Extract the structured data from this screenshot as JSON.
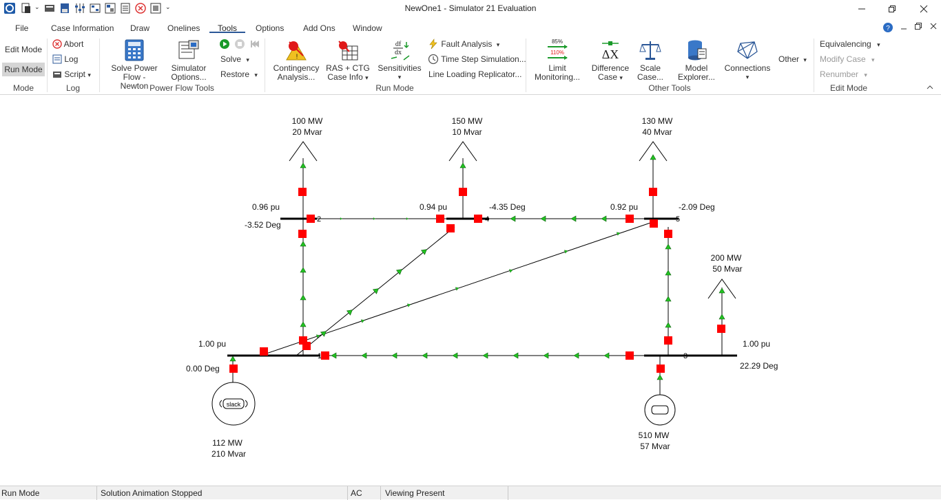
{
  "window": {
    "title": "NewOne1 - Simulator 21 Evaluation"
  },
  "menu": {
    "tabs": [
      "File",
      "Case Information",
      "Draw",
      "Onelines",
      "Tools",
      "Options",
      "Add Ons",
      "Window"
    ],
    "active_tab": "Tools"
  },
  "ribbon": {
    "mode": {
      "edit_mode": "Edit Mode",
      "run_mode": "Run Mode",
      "group": "Mode"
    },
    "log": {
      "abort": "Abort",
      "log": "Log",
      "script": "Script",
      "group": "Log"
    },
    "power_flow_tools": {
      "solve_line1": "Solve Power",
      "solve_line2": "Flow - Newton",
      "options_line1": "Simulator",
      "options_line2": "Options...",
      "solve": "Solve",
      "restore": "Restore",
      "group": "Power Flow Tools"
    },
    "run_mode": {
      "contingency_line1": "Contingency",
      "contingency_line2": "Analysis...",
      "ras_line1": "RAS + CTG",
      "ras_line2": "Case Info",
      "sensitivities": "Sensitivities",
      "fault_analysis": "Fault Analysis",
      "time_step": "Time Step Simulation...",
      "line_loading": "Line Loading Replicator...",
      "group": "Run Mode"
    },
    "other_tools": {
      "limit_line1": "Limit",
      "limit_line2": "Monitoring...",
      "limit_pct_top": "85%",
      "limit_pct_bottom": "110%",
      "difference_line1": "Difference",
      "difference_line2": "Case",
      "scale_line1": "Scale",
      "scale_line2": "Case...",
      "model_line1": "Model",
      "model_line2": "Explorer...",
      "connections": "Connections",
      "other": "Other",
      "group": "Other Tools"
    },
    "edit_mode": {
      "equivalencing": "Equivalencing",
      "modify_case": "Modify Case",
      "renumber": "Renumber",
      "group": "Edit Mode"
    }
  },
  "oneline": {
    "loads": [
      {
        "id": "load-bus2",
        "mw": "100 MW",
        "mvar": "20 Mvar"
      },
      {
        "id": "load-bus4",
        "mw": "150 MW",
        "mvar": "10 Mvar"
      },
      {
        "id": "load-bus5",
        "mw": "130 MW",
        "mvar": "40 Mvar"
      },
      {
        "id": "load-bus3",
        "mw": "200 MW",
        "mvar": "50 Mvar"
      }
    ],
    "buses": [
      {
        "number": "1",
        "voltage": "1.00 pu",
        "angle": "0.00 Deg"
      },
      {
        "number": "2",
        "voltage": "0.96 pu",
        "angle": "-3.52 Deg"
      },
      {
        "number": "3",
        "voltage": "1.00 pu",
        "angle": "22.29 Deg"
      },
      {
        "number": "4",
        "voltage": "0.94 pu",
        "angle": "-4.35 Deg"
      },
      {
        "number": "5",
        "voltage": "0.92 pu",
        "angle": "-2.09 Deg"
      }
    ],
    "generators": [
      {
        "id": "gen-bus1",
        "label": "slack",
        "mw": "112 MW",
        "mvar": "210 Mvar"
      },
      {
        "id": "gen-bus3",
        "mw": "510 MW",
        "mvar": "57 Mvar"
      }
    ],
    "colors": {
      "bus": "#000000",
      "line": "#000000",
      "breaker": "#ff0000",
      "flow_arrow": "#22c322"
    }
  },
  "status": {
    "mode": "Run Mode",
    "animation": "Solution Animation Stopped",
    "ac": "AC",
    "viewing": "Viewing Present"
  }
}
